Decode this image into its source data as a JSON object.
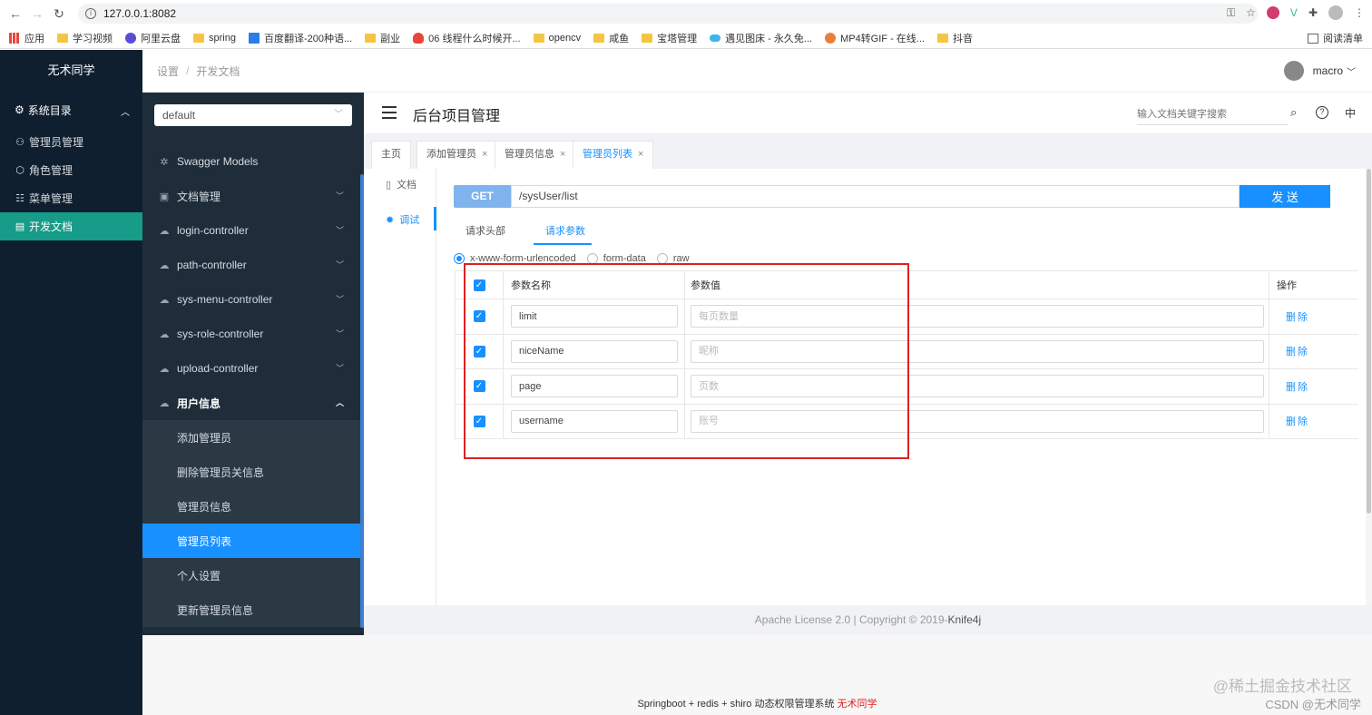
{
  "browser": {
    "url": "127.0.0.1:8082",
    "bookmarks": [
      "应用",
      "学习视频",
      "阿里云盘",
      "spring",
      "百度翻译-200种语...",
      "副业",
      "06 线程什么时候开...",
      "opencv",
      "咸鱼",
      "宝塔管理",
      "遇见图床 - 永久免...",
      "MP4转GIF - 在线...",
      "抖音"
    ],
    "reading_list": "阅读清单"
  },
  "app": {
    "title": "无术同学",
    "group": "系统目录",
    "menu": [
      "管理员管理",
      "角色管理",
      "菜单管理",
      "开发文档"
    ]
  },
  "breadcrumb": {
    "first": "设置",
    "sep": "/",
    "current": "开发文档"
  },
  "user": {
    "name": "macro"
  },
  "swagger": {
    "group_select": "default",
    "menu": [
      "Swagger Models",
      "文档管理",
      "login-controller",
      "path-controller",
      "sys-menu-controller",
      "sys-role-controller",
      "upload-controller"
    ],
    "open_group": "用户信息",
    "sub_menu": [
      "添加管理员",
      "删除管理员关信息",
      "管理员信息",
      "管理员列表",
      "个人设置",
      "更新管理员信息"
    ]
  },
  "main": {
    "title": "后台项目管理",
    "search_placeholder": "输入文档关键字搜索",
    "lang": "中",
    "tabs": [
      "主页",
      "添加管理员",
      "管理员信息",
      "管理员列表"
    ],
    "side_tabs": [
      "文档",
      "调试"
    ]
  },
  "request": {
    "method": "GET",
    "url": "/sysUser/list",
    "send": "发 送",
    "sub_tabs": [
      "请求头部",
      "请求参数"
    ],
    "body_types": [
      "x-www-form-urlencoded",
      "form-data",
      "raw"
    ],
    "headers": {
      "name": "参数名称",
      "value": "参数值",
      "op": "操作"
    },
    "delete_label": "删除",
    "params": [
      {
        "name": "limit",
        "placeholder": "每页数量"
      },
      {
        "name": "niceName",
        "placeholder": "昵称"
      },
      {
        "name": "page",
        "placeholder": "页数"
      },
      {
        "name": "username",
        "placeholder": "账号"
      }
    ]
  },
  "footer": {
    "license_prefix": "Apache License 2.0 | Copyright ",
    "copyright_symbol": "©",
    "year": " 2019-",
    "brand": "Knife4j",
    "bottom_text": "Springboot + redis + shiro 动态权限管理系统 ",
    "bottom_author": "无术同学"
  },
  "watermark": {
    "line1": "@稀土掘金技术社区",
    "line2": "CSDN @无术同学"
  }
}
